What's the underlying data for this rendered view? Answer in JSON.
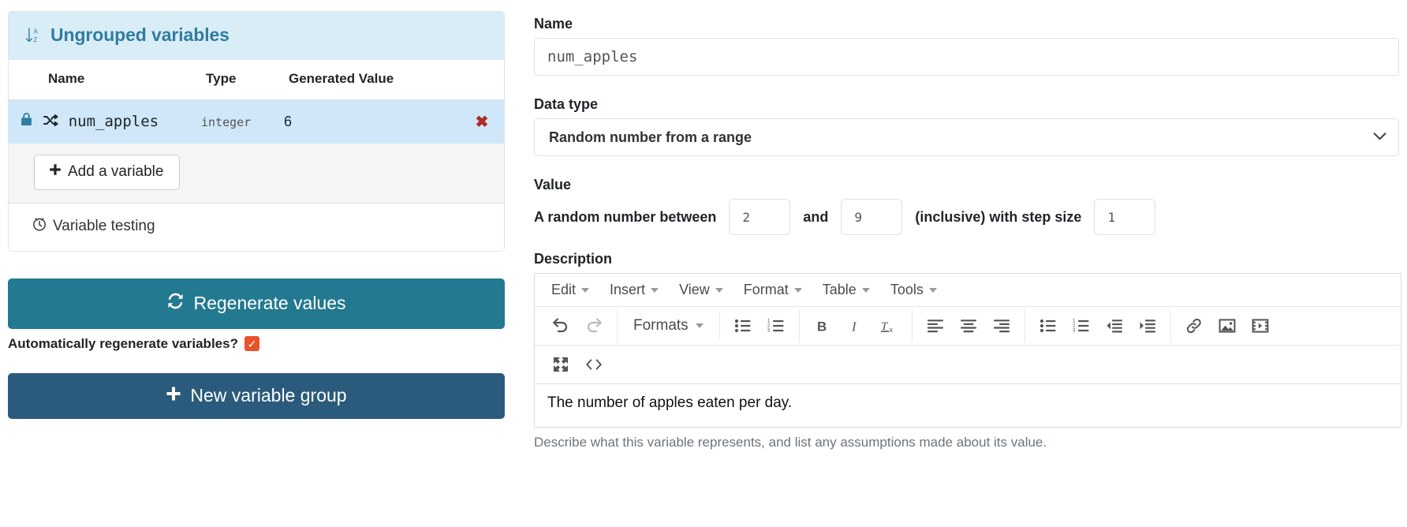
{
  "variable_group": {
    "sort_icon": "sort-alpha-down-icon",
    "title": "Ungrouped variables",
    "columns": [
      "Name",
      "Type",
      "Generated Value"
    ],
    "rows": [
      {
        "lock_icon": "lock-icon",
        "shuffle_icon": "shuffle-icon",
        "name": "num_apples",
        "type": "integer",
        "generated_value": "6",
        "delete_icon": "✖"
      }
    ],
    "add_variable_label": "Add a variable",
    "add_variable_icon": "plus-icon",
    "variable_testing_label": "Variable testing",
    "variable_testing_icon": "clock-icon"
  },
  "actions": {
    "regenerate_label": "Regenerate values",
    "regenerate_icon": "refresh-icon",
    "auto_regenerate_label": "Automatically regenerate variables?",
    "auto_regenerate_checked": "✓",
    "new_group_label": "New variable group",
    "new_group_icon": "plus-icon"
  },
  "form": {
    "name_label": "Name",
    "name_value": "num_apples",
    "data_type_label": "Data type",
    "data_type_value": "Random number from a range",
    "data_type_chevron": "chevron-down-icon",
    "value_label": "Value",
    "value_prefix": "A random number between",
    "value_min": "2",
    "value_and": "and",
    "value_max": "9",
    "value_suffix": "(inclusive) with step size",
    "value_step": "1",
    "description_label": "Description",
    "description_text": "The number of apples eaten per day.",
    "description_help": "Describe what this variable represents, and list any assumptions made about its value."
  },
  "editor": {
    "menubar": [
      "Edit",
      "Insert",
      "View",
      "Format",
      "Table",
      "Tools"
    ],
    "formats_label": "Formats",
    "toolbar_row1": [
      "undo-icon",
      "redo-icon",
      "formats-dropdown",
      "bullet-list-icon",
      "numbered-list-icon",
      "bold-icon",
      "italic-icon",
      "clear-formatting-icon",
      "align-left-icon",
      "align-center-icon",
      "align-right-icon",
      "unordered-list-icon",
      "ordered-list-icon",
      "outdent-icon",
      "indent-icon",
      "link-icon",
      "image-icon",
      "media-icon"
    ],
    "toolbar_row2": [
      "fullscreen-icon",
      "source-code-icon"
    ]
  },
  "colors": {
    "header_bg": "#d9edf7",
    "accent": "#2f7da0",
    "row_highlight": "#cfe7f8",
    "regenerate_bg": "#23798f",
    "newgroup_bg": "#2b5b7c",
    "checkbox_on": "#e8542a",
    "delete_red": "#b02a2a"
  }
}
